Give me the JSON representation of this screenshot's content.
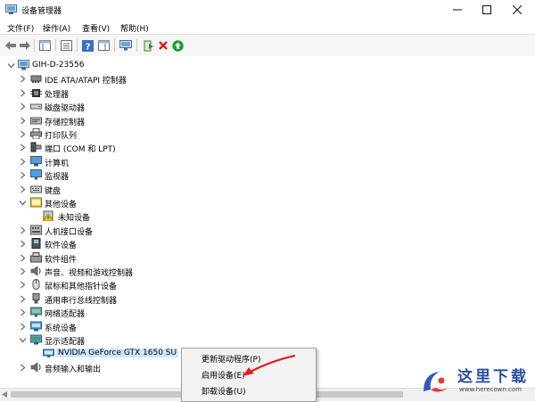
{
  "window": {
    "title": "设备管理器"
  },
  "menu": [
    {
      "label": "文件(F)"
    },
    {
      "label": "操作(A)"
    },
    {
      "label": "查看(V)"
    },
    {
      "label": "帮助(H)"
    }
  ],
  "tree": {
    "root": {
      "label": "GIH-D-23556"
    },
    "items": [
      {
        "label": "IDE ATA/ATAPI 控制器",
        "icon": "ide-controller-icon"
      },
      {
        "label": "处理器",
        "icon": "processor-icon"
      },
      {
        "label": "磁盘驱动器",
        "icon": "disk-drive-icon"
      },
      {
        "label": "存储控制器",
        "icon": "storage-controller-icon"
      },
      {
        "label": "打印队列",
        "icon": "printer-icon"
      },
      {
        "label": "端口 (COM 和 LPT)",
        "icon": "port-icon"
      },
      {
        "label": "计算机",
        "icon": "computer-icon"
      },
      {
        "label": "监视器",
        "icon": "monitor-icon"
      },
      {
        "label": "键盘",
        "icon": "keyboard-icon"
      },
      {
        "label": "其他设备",
        "icon": "other-devices-icon",
        "children": [
          {
            "label": "未知设备",
            "icon": "unknown-device-warning-icon"
          }
        ]
      },
      {
        "label": "人机接口设备",
        "icon": "hid-icon"
      },
      {
        "label": "软件设备",
        "icon": "software-device-icon"
      },
      {
        "label": "软件组件",
        "icon": "software-component-icon"
      },
      {
        "label": "声音、视频和游戏控制器",
        "icon": "sound-icon"
      },
      {
        "label": "鼠标和其他指针设备",
        "icon": "mouse-icon"
      },
      {
        "label": "通用串行总线控制器",
        "icon": "usb-icon"
      },
      {
        "label": "网络适配器",
        "icon": "network-adapter-icon"
      },
      {
        "label": "系统设备",
        "icon": "system-device-icon"
      },
      {
        "label": "显示适配器",
        "icon": "display-adapter-icon",
        "children": [
          {
            "label": "NVIDIA GeForce GTX 1650 SU",
            "icon": "gpu-icon"
          }
        ]
      },
      {
        "label": "音频输入和输出",
        "icon": "audio-io-icon"
      }
    ]
  },
  "context_menu": {
    "items": [
      {
        "label": "更新驱动程序(P)"
      },
      {
        "label": "启用设备(E)"
      },
      {
        "label": "卸载设备(U)"
      }
    ]
  },
  "watermark": {
    "text": "这里下载",
    "url": "www.herecown.com"
  }
}
